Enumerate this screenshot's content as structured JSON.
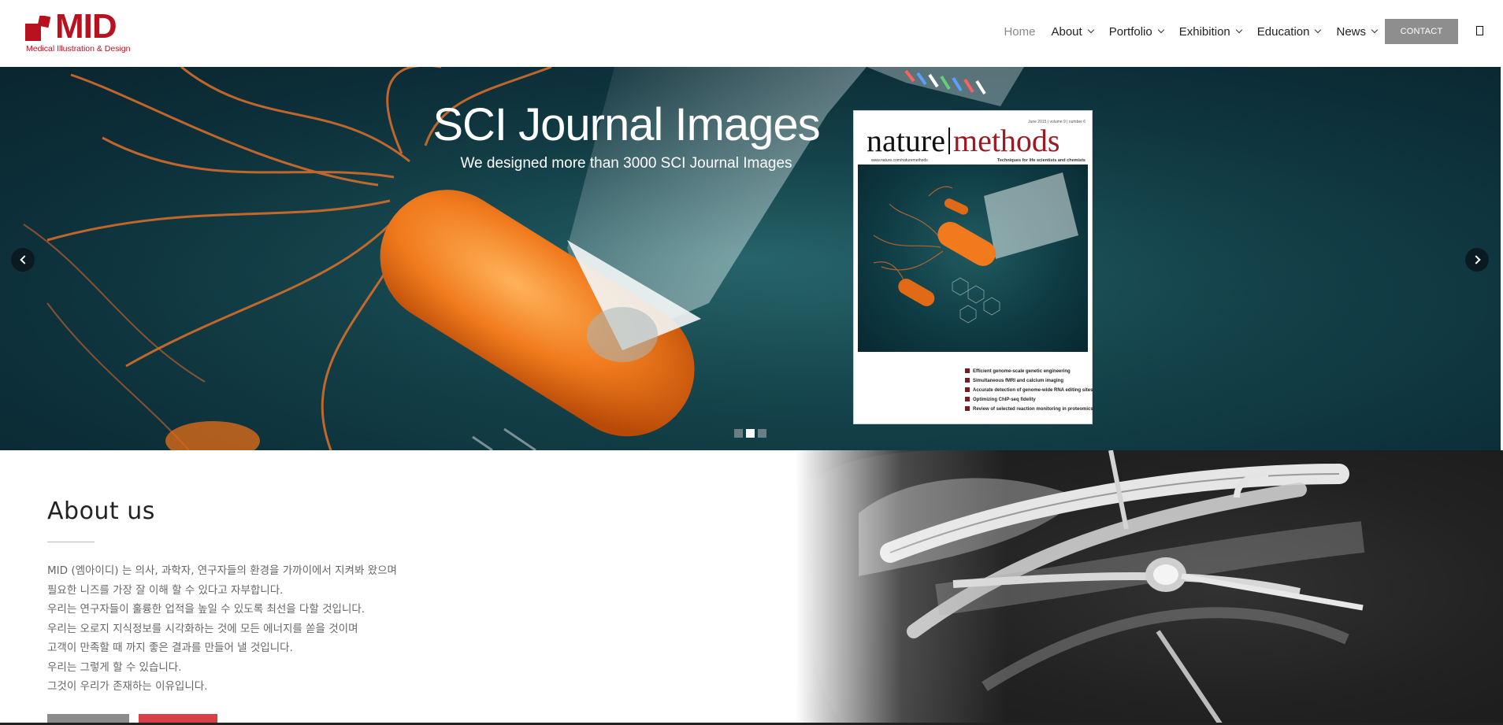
{
  "brand": {
    "name": "MID",
    "tagline": "Medical Illustration & Design",
    "color": "#b8121e"
  },
  "nav": {
    "items": [
      {
        "label": "Home",
        "has_dropdown": false,
        "active": true
      },
      {
        "label": "About",
        "has_dropdown": true
      },
      {
        "label": "Portfolio",
        "has_dropdown": true
      },
      {
        "label": "Exhibition",
        "has_dropdown": true
      },
      {
        "label": "Education",
        "has_dropdown": true
      },
      {
        "label": "News",
        "has_dropdown": true
      }
    ],
    "contact_label": "CONTACT",
    "search_icon": "search-icon"
  },
  "hero": {
    "title": "SCI Journal Images",
    "subtitle": "We designed more than 3000 SCI Journal Images",
    "slide_count": 3,
    "active_slide": 2,
    "prev_icon": "chevron-left-icon",
    "next_icon": "chevron-right-icon",
    "cover": {
      "masthead_left": "nature",
      "masthead_right": "methods",
      "meta": "June 2015 | volume 9 | number 6",
      "url": "www.nature.com/naturemethods",
      "tagline": "Techniques for life scientists and chemists",
      "contents": [
        "Efficient genome-scale genetic engineering",
        "Simultaneous fMRI and calcium imaging",
        "Accurate detection of genome-wide RNA editing sites",
        "Optimizing ChIP-seq fidelity",
        "Review of selected reaction monitoring in proteomics"
      ]
    }
  },
  "about": {
    "title": "About us",
    "paragraphs": [
      "MID (엠아이디) 는 의사, 과학자, 연구자들의 환경을 가까이에서 지켜봐 왔으며",
      "필요한 니즈를 가장 잘 이해 할 수 있다고 자부합니다.",
      "우리는 연구자들이 훌륭한 업적을 높일 수 있도록 최선을 다할 것입니다.",
      "우리는 오로지 지식정보를 시각화하는 것에 모든 에너지를 쏟을 것이며",
      "고객이 만족할 때 까지 좋은 결과를 만들어 낼 것입니다.",
      "우리는 그렇게 할 수 있습니다.",
      "그것이 우리가 존재하는 이유입니다."
    ]
  },
  "colors": {
    "accent_red": "#d84048",
    "button_gray": "#8c8c8c",
    "hero_teal": "#134048",
    "bacterium_orange": "#f07a1c"
  }
}
